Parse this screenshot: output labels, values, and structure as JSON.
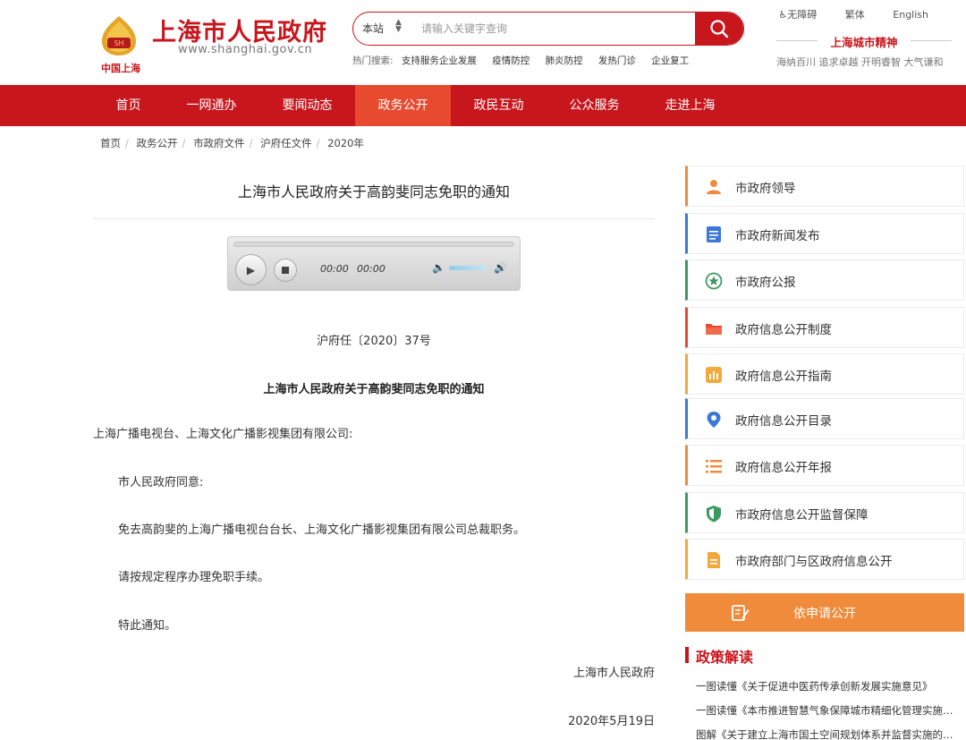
{
  "header": {
    "logo_text": "中国上海",
    "site_title": "上海市人民政府",
    "site_url": "www.shanghai.gov.cn",
    "search": {
      "scope": "本站",
      "placeholder": "请输入关键字查询"
    },
    "hot_label": "热门搜索:",
    "hot_terms": [
      "支持服务企业发展",
      "疫情防控",
      "肺炎防控",
      "发热门诊",
      "企业复工"
    ],
    "top_links": [
      "无障碍",
      "繁体",
      "English"
    ],
    "spirit_title": "上海城市精神",
    "spirit_text": "海纳百川 追求卓越 开明睿智 大气谦和"
  },
  "nav": {
    "items": [
      "首页",
      "一网通办",
      "要闻动态",
      "政务公开",
      "政民互动",
      "公众服务",
      "走进上海"
    ],
    "active_index": 3
  },
  "breadcrumb": [
    "首页",
    "政务公开",
    "市政府文件",
    "沪府任文件",
    "2020年"
  ],
  "article": {
    "title": "上海市人民政府关于高韵斐同志免职的通知",
    "player": {
      "current_time": "00:00",
      "duration": "00:00"
    },
    "doc_no": "沪府任〔2020〕37号",
    "doc_title": "上海市人民政府关于高韵斐同志免职的通知",
    "addressee": "上海广播电视台、上海文化广播影视集团有限公司:",
    "paragraphs": [
      "市人民政府同意:",
      "免去高韵斐的上海广播电视台台长、上海文化广播影视集团有限公司总裁职务。",
      "请按规定程序办理免职手续。",
      "特此通知。"
    ],
    "signature": "上海市人民政府",
    "date": "2020年5月19日"
  },
  "sidebar": {
    "items": [
      {
        "label": "市政府领导",
        "icon": "person-icon",
        "color": "#f08b3b"
      },
      {
        "label": "市政府新闻发布",
        "icon": "document-icon",
        "color": "#3b78d8"
      },
      {
        "label": "市政府公报",
        "icon": "star-icon",
        "color": "#3c9a5f"
      },
      {
        "label": "政府信息公开制度",
        "icon": "folder-icon",
        "color": "#e54b33"
      },
      {
        "label": "政府信息公开指南",
        "icon": "chart-icon",
        "color": "#f2a93b"
      },
      {
        "label": "政府信息公开目录",
        "icon": "location-icon",
        "color": "#3b78d8"
      },
      {
        "label": "政府信息公开年报",
        "icon": "list-icon",
        "color": "#f08b3b"
      },
      {
        "label": "市政府信息公开监督保障",
        "icon": "shield-icon",
        "color": "#3c9a5f"
      },
      {
        "label": "市政府部门与区政府信息公开",
        "icon": "file-icon",
        "color": "#f2a93b"
      }
    ],
    "apply_label": "依申请公开",
    "policy_title": "政策解读",
    "policy_items": [
      "一图读懂《关于促进中医药传承创新发展实施意见》",
      "一图读懂《本市推进智慧气象保障城市精细化管理实施意见》",
      "图解《关于建立上海市国土空间规划体系并监督实施的意见》"
    ]
  },
  "colors": {
    "brand_red": "#c8161d",
    "nav_active": "#e74a2f",
    "accent_orange": "#f08b3b"
  }
}
